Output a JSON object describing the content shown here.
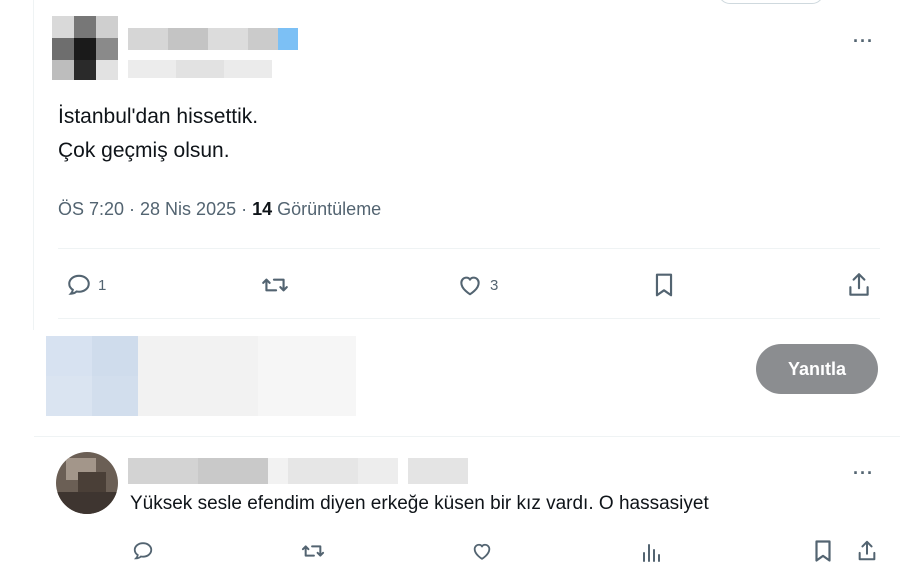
{
  "tweet": {
    "text_line1": "İstanbul'dan hissettik.",
    "text_line2": "Çok geçmiş olsun.",
    "time": "ÖS 7:20 · 28 Nis 2025 · ",
    "views_count": "14",
    "views_label": " Görüntüleme",
    "actions": {
      "reply_count": "1",
      "like_count": "3"
    }
  },
  "composer": {
    "reply_button_label": "Yanıtla"
  },
  "reply": {
    "text": "Yüksek sesle efendim diyen erkeğe küsen bir kız vardı. O hassasiyet"
  },
  "icons": {
    "more": "more-icon",
    "reply": "reply-icon",
    "retweet": "retweet-icon",
    "like": "like-icon",
    "bookmark": "bookmark-icon",
    "share": "share-icon",
    "analytics": "analytics-icon"
  },
  "colors": {
    "text": "#0f1419",
    "secondary": "#536471",
    "reply_button_bg": "#8b8d90"
  }
}
